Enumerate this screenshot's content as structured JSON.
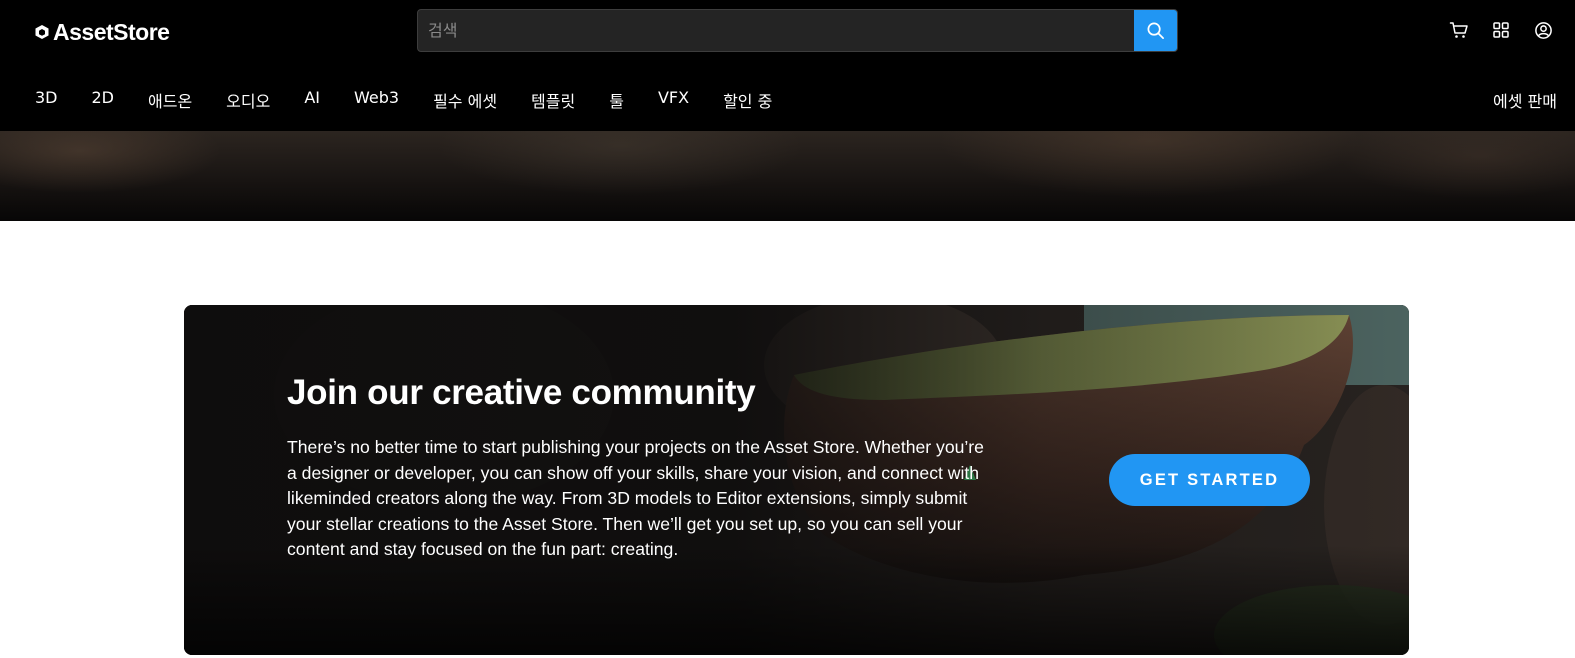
{
  "header": {
    "logo_text": "AssetStore",
    "search": {
      "placeholder": "검색",
      "value": ""
    },
    "icons": [
      "cart-icon",
      "apps-grid-icon",
      "account-icon"
    ]
  },
  "nav": {
    "items": [
      "3D",
      "2D",
      "애드온",
      "오디오",
      "AI",
      "Web3",
      "필수 에셋",
      "템플릿",
      "툴",
      "VFX",
      "할인 중"
    ],
    "sell_label": "에셋 판매"
  },
  "banner": {
    "title": "Join our creative community",
    "text": "There’s no better time to start publishing your projects on the Asset Store. Whether you’re a designer or developer, you can show off your skills, share your vision, and connect with likeminded creators along the way. From 3D models to Editor extensions, simply submit your stellar creations to the Asset Store. Then we’ll get you set up, so you can sell your content and stay focused on the fun part: creating.",
    "cta_label": "GET STARTED"
  },
  "colors": {
    "accent": "#2196f3",
    "header_bg": "#000000",
    "page_bg": "#ffffff"
  }
}
